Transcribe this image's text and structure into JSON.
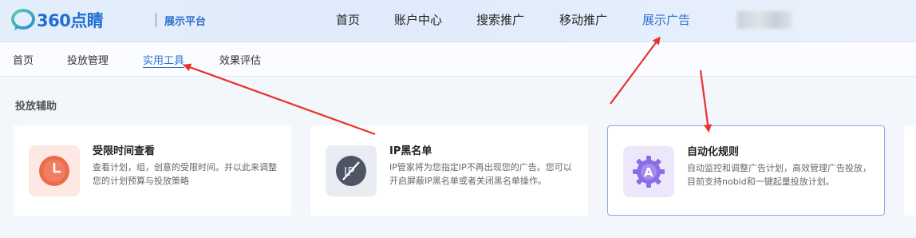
{
  "header": {
    "logo_text": "360点睛",
    "platform_label": "展示平台",
    "nav": [
      {
        "label": "首页"
      },
      {
        "label": "账户中心"
      },
      {
        "label": "搜索推广"
      },
      {
        "label": "移动推广"
      },
      {
        "label": "展示广告",
        "active": true
      }
    ]
  },
  "subnav": [
    {
      "label": "首页"
    },
    {
      "label": "投放管理"
    },
    {
      "label": "实用工具",
      "active": true
    },
    {
      "label": "效果评估"
    }
  ],
  "section": {
    "title": "投放辅助",
    "cards": [
      {
        "title": "受限时间查看",
        "desc": "查看计划，组，创意的受限时间。并以此来调整您的计划预算与投放策略",
        "icon": "clock-icon"
      },
      {
        "title": "IP黑名单",
        "desc": "IP管家将为您指定IP不再出现您的广告。您可以开启屏蔽IP黑名单或者关闭黑名单操作。",
        "icon": "ip-block-icon"
      },
      {
        "title": "自动化规则",
        "desc": "自动监控和调整广告计划，高效管理广告投放，目前支持nobid和一键起量投放计划。",
        "icon": "automation-gear-icon",
        "selected": true
      }
    ]
  },
  "colors": {
    "accent": "#2f6fd0",
    "annotation_arrow": "#e8322b"
  }
}
